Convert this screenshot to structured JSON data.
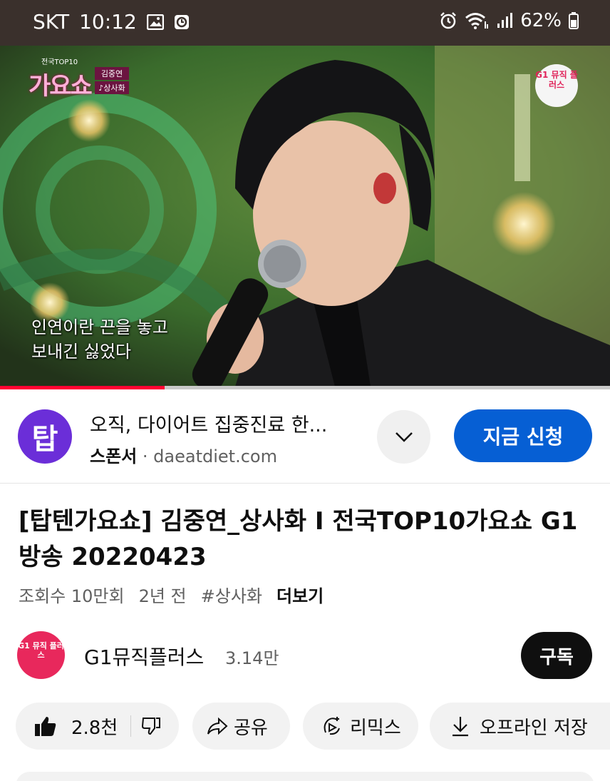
{
  "status_bar": {
    "carrier": "SKT",
    "time": "10:12",
    "battery": "62%"
  },
  "video": {
    "show_logo_top": "전국TOP10",
    "show_logo": "가요쇼",
    "show_singer": "김중연",
    "show_song": "♪상사화",
    "channel_badge": "G1 뮤직 플러스",
    "subtitle_line1": "인연이란 끈을 놓고",
    "subtitle_line2": "보내긴 싫었다",
    "progress": 0.27
  },
  "ad": {
    "logo_text": "탑",
    "title": "오직, 다이어트 집중진료 한...",
    "sponsor_label": "스폰서",
    "separator": "·",
    "domain": "daeatdiet.com",
    "cta": "지금 신청"
  },
  "video_info": {
    "title": "[탑텐가요쇼] 김중연_상사화 I 전국TOP10가요쇼 G1방송 20220423",
    "views": "조회수 10만회",
    "age": "2년 전",
    "hashtag": "#상사화",
    "more": "더보기"
  },
  "channel": {
    "avatar_text": "G1 뮤직 플러스",
    "name": "G1뮤직플러스",
    "subscribers": "3.14만",
    "subscribe_label": "구독"
  },
  "actions": {
    "likes": "2.8천",
    "share": "공유",
    "remix": "리믹스",
    "offline": "오프라인 저장"
  },
  "colors": {
    "status_bar": "#3a302c",
    "accent_blue": "#065fd4",
    "progress_red": "#ff0033",
    "chip_bg": "#f2f2f2"
  }
}
